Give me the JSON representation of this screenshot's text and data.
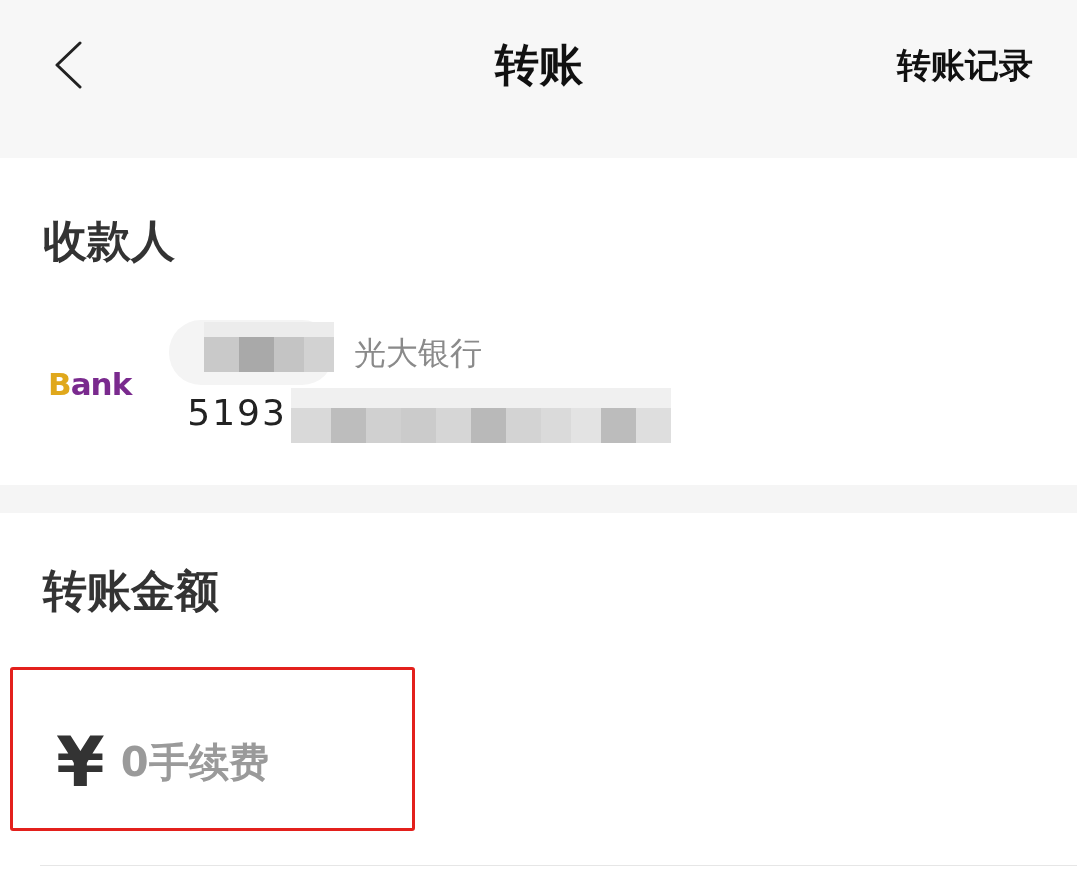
{
  "header": {
    "title": "转账",
    "action": "转账记录"
  },
  "payee": {
    "heading": "收款人",
    "bank_logo": "Bank",
    "bank_name": "光大银行",
    "card_number": "5193"
  },
  "amount": {
    "heading": "转账金额",
    "currency": "¥",
    "placeholder": "0手续费"
  }
}
